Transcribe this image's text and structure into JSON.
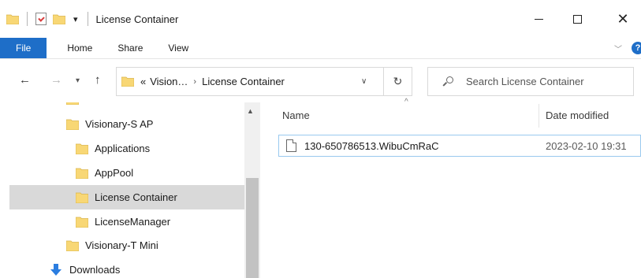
{
  "window": {
    "title": "License Container",
    "quick_access_arrow": "▾",
    "controls": {
      "close": "✕"
    }
  },
  "ribbon": {
    "tabs": [
      {
        "label": "File"
      },
      {
        "label": "Home"
      },
      {
        "label": "Share"
      },
      {
        "label": "View"
      }
    ],
    "help": "?"
  },
  "address": {
    "prefix": "«",
    "crumbs": [
      "Vision…",
      "License Container"
    ],
    "separator": "›"
  },
  "search": {
    "placeholder": "Search License Container"
  },
  "nav_tree": {
    "items": [
      {
        "label": "Visionary-S AP",
        "icon": "folder-icon",
        "selected": false
      },
      {
        "label": "Applications",
        "icon": "folder-icon",
        "selected": false
      },
      {
        "label": "AppPool",
        "icon": "folder-icon",
        "selected": false
      },
      {
        "label": "License Container",
        "icon": "folder-icon",
        "selected": true
      },
      {
        "label": "LicenseManager",
        "icon": "folder-icon",
        "selected": false
      },
      {
        "label": "Visionary-T Mini",
        "icon": "folder-icon",
        "selected": false
      },
      {
        "label": "Downloads",
        "icon": "download-arrow-icon",
        "selected": false
      }
    ]
  },
  "file_list": {
    "columns": [
      "Name",
      "Date modified"
    ],
    "rows": [
      {
        "name": "130-650786513.WibuCmRaC",
        "date_modified": "2023-02-10 19:31"
      }
    ]
  },
  "colors": {
    "accent": "#1e6ec8",
    "folder": "#f8d775",
    "selection": "#d9d9d9",
    "row_highlight": "#99c9ef"
  }
}
